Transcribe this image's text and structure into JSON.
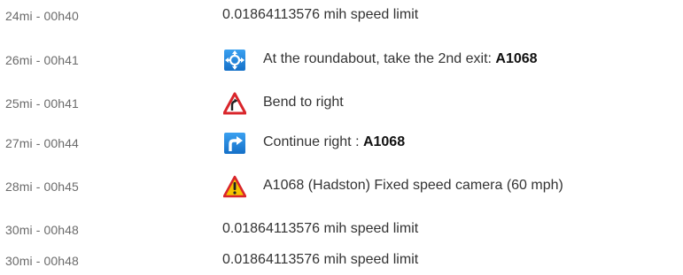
{
  "route": {
    "steps": [
      {
        "distance_time": "24mi - 00h40",
        "instruction": "0.01864113576 mih speed limit",
        "road": "",
        "icon": ""
      },
      {
        "distance_time": "26mi - 00h41",
        "instruction": "At the roundabout, take the 2nd exit: ",
        "road": "A1068",
        "icon": "roundabout-icon"
      },
      {
        "distance_time": "25mi - 00h41",
        "instruction": "Bend to right",
        "road": "",
        "icon": "bend-right-warning-icon"
      },
      {
        "distance_time": "27mi - 00h44",
        "instruction": "Continue right : ",
        "road": "A1068",
        "icon": "turn-right-icon"
      },
      {
        "distance_time": "28mi - 00h45",
        "instruction": "A1068 (Hadston) Fixed speed camera (60 mph)",
        "road": "",
        "icon": "speed-camera-warning-icon"
      },
      {
        "distance_time": "30mi - 00h48",
        "instruction": "0.01864113576 mih speed limit",
        "road": "",
        "icon": ""
      },
      {
        "distance_time": "30mi - 00h48",
        "instruction": "0.01864113576 mih speed limit",
        "road": "",
        "icon": ""
      }
    ]
  },
  "colors": {
    "distance_text": "#6b6b6b",
    "instruction_text": "#333333",
    "sign_blue": "#1a7fd4",
    "warning_red": "#d9252b",
    "warning_yellow": "#f5c400"
  }
}
